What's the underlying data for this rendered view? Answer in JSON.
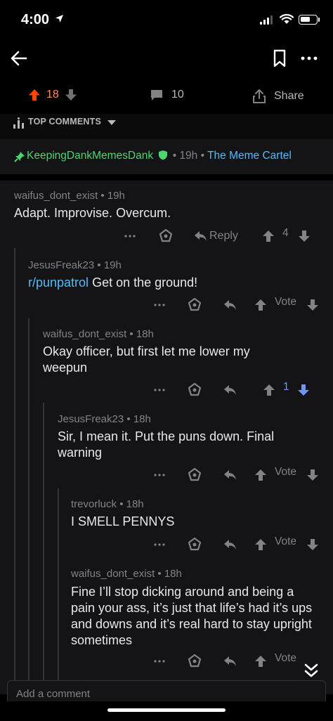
{
  "status": {
    "time": "4:00"
  },
  "post_bar": {
    "vote_count": "18",
    "comment_count": "10",
    "share_label": "Share"
  },
  "top_comments": {
    "label": "TOP COMMENTS"
  },
  "pinned": {
    "username": "KeepingDankMemesDank",
    "age": "19h",
    "subreddit": "The Meme Cartel"
  },
  "comments": [
    {
      "username": "waifus_dont_exist",
      "age": "19h",
      "body": "Adapt. Improvise. Overcum.",
      "reply_label": "Reply",
      "score": "4"
    },
    {
      "username": "JesusFreak23",
      "age": "19h",
      "link": "r/punpatrol",
      "body": " Get on the ground!",
      "score": "Vote"
    },
    {
      "username": "waifus_dont_exist",
      "age": "18h",
      "body": "Okay officer, but first let me lower my weepun",
      "score": "1"
    },
    {
      "username": "JesusFreak23",
      "age": "18h",
      "body": "Sir, I mean it. Put the puns down. Final warning",
      "score": "Vote"
    },
    {
      "username": "trevorluck",
      "age": "18h",
      "body": "I SMELL PENNYS",
      "score": "Vote"
    },
    {
      "username": "waifus_dont_exist",
      "age": "18h",
      "body": "Fine I’ll stop dicking around and being a pain your ass, it’s just that life’s had it’s ups and downs and it’s real hard to stay upright sometimes",
      "score": "Vote"
    }
  ],
  "add_comment": {
    "placeholder": "Add a comment"
  },
  "colors": {
    "upvote_orange": "#ff4500",
    "downvote_blue": "#7193ff",
    "mod_green": "#4bd672",
    "link_blue": "#4fbcff"
  }
}
